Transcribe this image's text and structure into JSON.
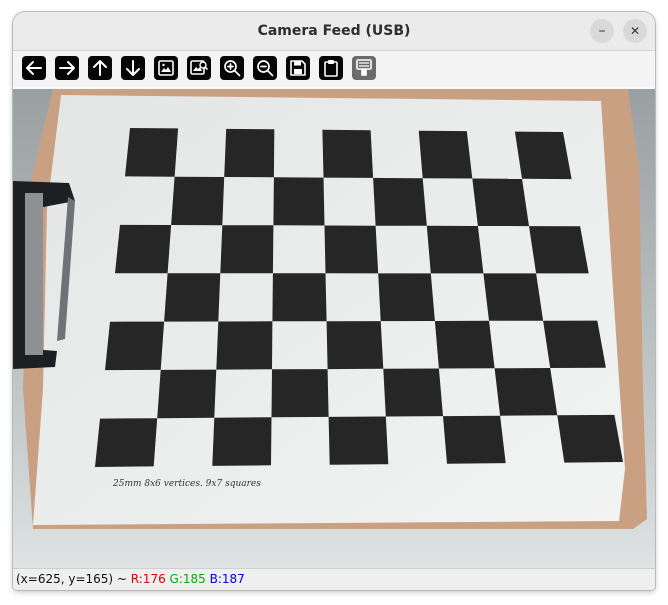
{
  "window": {
    "title": "Camera Feed (USB)",
    "minimize_glyph": "–",
    "close_glyph": "✕"
  },
  "toolbar": {
    "buttons": [
      {
        "icon": "arrow-left-icon"
      },
      {
        "icon": "arrow-right-icon"
      },
      {
        "icon": "arrow-up-icon"
      },
      {
        "icon": "arrow-down-icon"
      },
      {
        "icon": "image-icon"
      },
      {
        "icon": "image-zoom-icon"
      },
      {
        "icon": "zoom-in-icon"
      },
      {
        "icon": "zoom-out-icon"
      },
      {
        "icon": "save-icon"
      },
      {
        "icon": "clipboard-icon"
      },
      {
        "icon": "properties-icon",
        "disabled": true
      }
    ]
  },
  "image": {
    "paper_note": "25mm    8x6  vertices.   9x7  squares"
  },
  "status": {
    "coords": "(x=625, y=165) ~ ",
    "r": "R:176",
    "g": "G:185",
    "b": "B:187"
  }
}
